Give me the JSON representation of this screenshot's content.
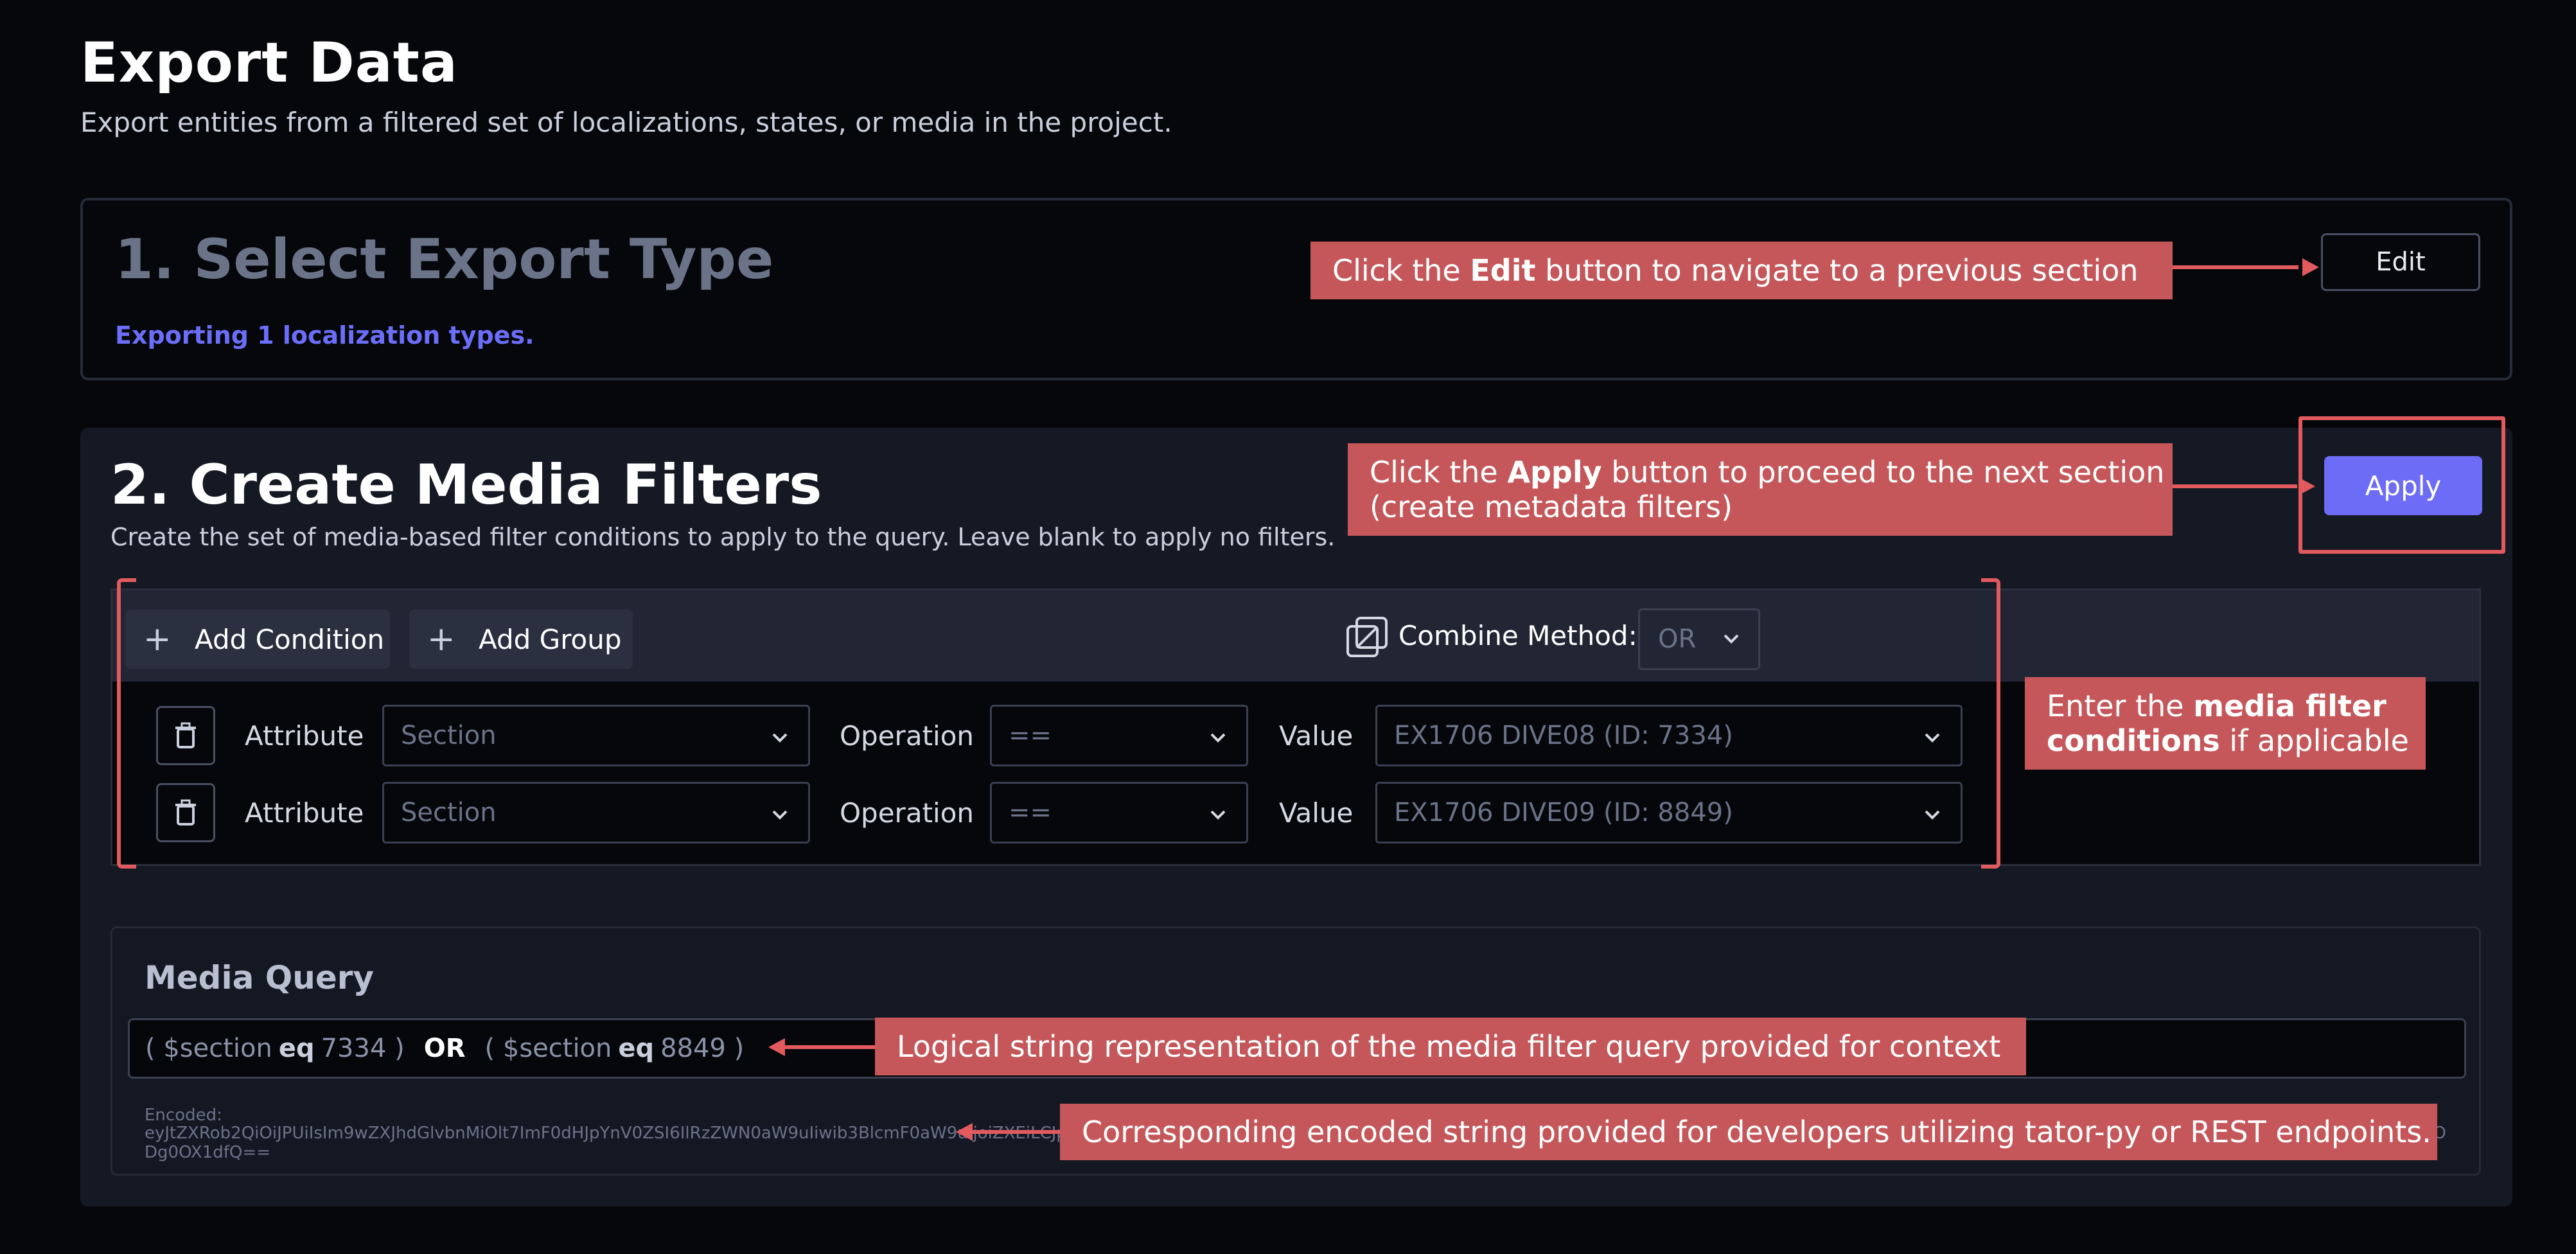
{
  "page": {
    "title": "Export Data",
    "subtitle": "Export entities from a filtered set of localizations, states, or media in the project."
  },
  "section1": {
    "title": "1. Select Export Type",
    "note": "Exporting 1 localization types.",
    "edit_label": "Edit"
  },
  "section2": {
    "title": "2. Create Media Filters",
    "subtitle": "Create the set of media-based filter conditions to apply to the query. Leave blank to apply no filters.",
    "apply_label": "Apply",
    "toolbar": {
      "add_condition": "Add Condition",
      "add_group": "Add Group",
      "combine_label": "Combine Method:",
      "combine_value": "OR"
    },
    "conditions": [
      {
        "attribute_label": "Attribute",
        "attribute": "Section",
        "operation_label": "Operation",
        "operation": "==",
        "value_label": "Value",
        "value": "EX1706 DIVE08 (ID: 7334)"
      },
      {
        "attribute_label": "Attribute",
        "attribute": "Section",
        "operation_label": "Operation",
        "operation": "==",
        "value_label": "Value",
        "value": "EX1706 DIVE09 (ID: 8849)"
      }
    ],
    "media_query": {
      "title": "Media Query",
      "q1_open": "( $section",
      "q1_op": "eq",
      "q1_val": "7334 )",
      "or": "OR",
      "q2_open": "( $section",
      "q2_op": "eq",
      "q2_val": "8849 )",
      "encoded_label": "Encoded:",
      "encoded_value": "eyJtZXRob2QiOiJPUiIsIm9wZXJhdGlvbnMiOlt7ImF0dHJpYnV0ZSI6IlRzZWN0aW9uIiwib3BlcmF0aW9uIjoiZXEiLCJpbnZlcnNlIjpmYWxzZSwidmFsdWUiOjczMzR9LHsiYXR0cmlidXRlIjoiJHNlY3Rpb24iLCJvcGVyYXRpb24iOiJlcSIsImludmVyc2UiOmZhbHNlLCJ2YWx1ZSI6ODg0OX1dfQ== 6ODg0OX1dfQ=="
    }
  },
  "callouts": {
    "edit_pre": "Click the ",
    "edit_bold": "Edit",
    "edit_post": " button to navigate to a previous section",
    "apply_pre": "Click the ",
    "apply_bold": "Apply",
    "apply_post": " button to proceed to the next section",
    "apply_line2": "(create metadata filters)",
    "filter_pre": "Enter the ",
    "filter_bold1": "media filter",
    "filter_bold2": "conditions",
    "filter_post": " if applicable",
    "logical": "Logical string representation of the media filter query provided for context",
    "encoded": "Corresponding encoded string provided for developers utilizing tator-py or REST endpoints."
  },
  "colors": {
    "accent": "#6d6cf6",
    "callout": "#c5575a",
    "annotation_stroke": "#e05a5e",
    "background": "#05070b",
    "panel": "#151924"
  },
  "icons": [
    "plus-icon",
    "trash-icon",
    "combine-icon",
    "chevron-down-icon"
  ]
}
